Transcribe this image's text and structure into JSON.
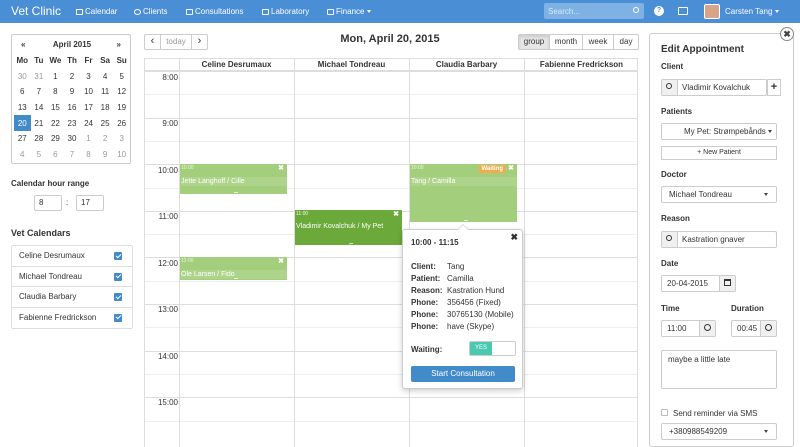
{
  "nav": {
    "brand": "Vet Clinic",
    "items": [
      "Calendar",
      "Clients",
      "Consultations",
      "Laboratory",
      "Finance"
    ],
    "search_placeholder": "Search...",
    "user": "Carsten Tang",
    "help": "?"
  },
  "mini": {
    "month": "April 2015",
    "prev": "«",
    "next": "»",
    "dow": [
      "Mo",
      "Tu",
      "We",
      "Th",
      "Fr",
      "Sa",
      "Su"
    ],
    "weeks": [
      [
        "30",
        "31",
        "1",
        "2",
        "3",
        "4",
        "5"
      ],
      [
        "6",
        "7",
        "8",
        "9",
        "10",
        "11",
        "12"
      ],
      [
        "13",
        "14",
        "15",
        "16",
        "17",
        "18",
        "19"
      ],
      [
        "20",
        "21",
        "22",
        "23",
        "24",
        "25",
        "26"
      ],
      [
        "27",
        "28",
        "29",
        "30",
        "1",
        "2",
        "3"
      ],
      [
        "4",
        "5",
        "6",
        "7",
        "8",
        "9",
        "10"
      ]
    ],
    "other": [
      [
        1,
        1,
        0,
        0,
        0,
        0,
        0
      ],
      [
        0,
        0,
        0,
        0,
        0,
        0,
        0
      ],
      [
        0,
        0,
        0,
        0,
        0,
        0,
        0
      ],
      [
        0,
        0,
        0,
        0,
        0,
        0,
        0
      ],
      [
        0,
        0,
        0,
        0,
        1,
        1,
        1
      ],
      [
        1,
        1,
        1,
        1,
        1,
        1,
        1
      ]
    ],
    "selected": [
      3,
      0
    ]
  },
  "range": {
    "label": "Calendar hour range",
    "from": "8",
    "sep": ":",
    "to": "17"
  },
  "vet_calendars": {
    "label": "Vet Calendars",
    "items": [
      "Celine Desrumaux",
      "Michael Tondreau",
      "Claudia Barbary",
      "Fabienne Fredrickson"
    ]
  },
  "toolbar": {
    "prev": "‹",
    "today": "today",
    "next": "›",
    "title": "Mon, April 20, 2015",
    "views": [
      "group",
      "month",
      "week",
      "day"
    ]
  },
  "columns": [
    "Celine Desrumaux",
    "Michael Tondreau",
    "Claudia Barbary",
    "Fabienne Fredrickson"
  ],
  "hours": [
    "8:00",
    "9:00",
    "10:00",
    "11:00",
    "12:00",
    "13:00",
    "14:00",
    "15:00"
  ],
  "events": [
    {
      "time": "10:00",
      "name": "Jette Langhoff / Cille",
      "close": "✖"
    },
    {
      "time": "11:00",
      "name": "Vladimir Kovalchuk / My Pet",
      "close": "✖"
    },
    {
      "time": "12:00",
      "name": "Ole Larsen / Fido",
      "close": "✖"
    },
    {
      "time": "10:00",
      "name": "Tang / Camilla",
      "close": "✖",
      "badge": "Waiting"
    }
  ],
  "popover": {
    "time": "10:00 - 11:15",
    "close": "✖",
    "rows": [
      [
        "Client:",
        "Tang"
      ],
      [
        "Patient:",
        "Camilla"
      ],
      [
        "Reason:",
        "Kastration Hund"
      ],
      [
        "Phone:",
        "356456 (Fixed)"
      ],
      [
        "Phone:",
        "30765130 (Mobile)"
      ],
      [
        "Phone:",
        "have (Skype)"
      ]
    ],
    "waiting_label": "Waiting:",
    "toggle": "YES",
    "button": "Start Consultation"
  },
  "edit": {
    "title": "Edit Appointment",
    "client_label": "Client",
    "client": "Vladimir Kovalchuk",
    "add": "+",
    "patients_label": "Patients",
    "patient": "My Pet: Strømpebånds",
    "new_patient": "+ New Patient",
    "doctor_label": "Doctor",
    "doctor": "Michael Tondreau",
    "reason_label": "Reason",
    "reason": "Kastration gnaver",
    "date_label": "Date",
    "date": "20-04-2015",
    "time_label": "Time",
    "time": "11:00",
    "duration_label": "Duration",
    "duration": "00:45",
    "notes": "maybe a little late",
    "sms_label": "Send reminder via SMS",
    "phone": "+380988549209",
    "close": "✖"
  }
}
